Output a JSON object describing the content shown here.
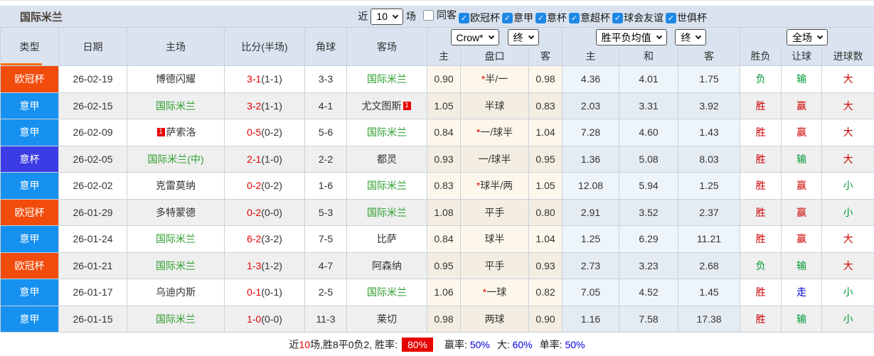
{
  "title": "国际米兰",
  "icons": {
    "check": "✓"
  },
  "colors": {
    "league": {
      "ucl": "#f14c0c",
      "serie_a": "#1791f0",
      "coppa": "#3c3ce6"
    },
    "inter_green": "#2e9e2e",
    "score_red": "#e60000",
    "star_red": "#e60000",
    "result": {
      "red": "#cc0000",
      "green": "#009933",
      "blue": "#0000cc"
    },
    "footer_red": "#e60000",
    "footer_blue": "#0000e0",
    "checkbox_blue": "#1e88e5",
    "accent_orange": "#ff7214"
  },
  "toolbar": {
    "recent_label": "近",
    "recent_value": "10",
    "matches_label": "场",
    "filters": [
      {
        "key": "same-venue",
        "label": "同客",
        "checked": false
      },
      {
        "key": "ucl",
        "label": "欧冠杯",
        "checked": true
      },
      {
        "key": "serie-a",
        "label": "意甲",
        "checked": true
      },
      {
        "key": "coppa-italia",
        "label": "意杯",
        "checked": true
      },
      {
        "key": "italian-super-cup",
        "label": "意超杯",
        "checked": true
      },
      {
        "key": "club-friendly",
        "label": "球会友谊",
        "checked": true
      },
      {
        "key": "club-world-cup",
        "label": "世俱杯",
        "checked": true
      }
    ]
  },
  "table": {
    "column_headers": [
      "类型",
      "日期",
      "主场",
      "比分(半场)",
      "角球",
      "客场"
    ],
    "sub_headers": [
      "主",
      "盘口",
      "客",
      "主",
      "和",
      "客",
      "胜负",
      "让球",
      "进球数"
    ],
    "selects": {
      "company": "Crow*",
      "company_time": "终",
      "avg": "胜平负均值",
      "avg_time": "终",
      "scope": "全场"
    },
    "rows": [
      {
        "league": "欧冠杯",
        "league_color": "ucl",
        "date": "26-02-19",
        "home": {
          "name": "博德闪耀",
          "inter": false,
          "red_card": null
        },
        "score": {
          "full": "3-1",
          "half": "(1-1)"
        },
        "corners": "3-3",
        "away": {
          "name": "国际米兰",
          "inter": true,
          "red_card": null
        },
        "crow": {
          "home": "0.90",
          "star": "*",
          "handicap": "半/一",
          "away": "0.98"
        },
        "avg": {
          "win": "4.36",
          "draw": "4.01",
          "lose": "1.75"
        },
        "results": {
          "outcome": {
            "text": "负",
            "color": "green"
          },
          "handicap": {
            "text": "输",
            "color": "green"
          },
          "goals": {
            "text": "大",
            "color": "red"
          }
        }
      },
      {
        "league": "意甲",
        "league_color": "serie_a",
        "date": "26-02-15",
        "home": {
          "name": "国际米兰",
          "inter": true,
          "red_card": null
        },
        "score": {
          "full": "3-2",
          "half": "(1-1)"
        },
        "corners": "4-1",
        "away": {
          "name": "尤文图斯",
          "inter": false,
          "red_card": {
            "count": "1",
            "position": "after"
          }
        },
        "crow": {
          "home": "1.05",
          "star": "",
          "handicap": "半球",
          "away": "0.83"
        },
        "avg": {
          "win": "2.03",
          "draw": "3.31",
          "lose": "3.92"
        },
        "results": {
          "outcome": {
            "text": "胜",
            "color": "red"
          },
          "handicap": {
            "text": "赢",
            "color": "red"
          },
          "goals": {
            "text": "大",
            "color": "red"
          }
        }
      },
      {
        "league": "意甲",
        "league_color": "serie_a",
        "date": "26-02-09",
        "home": {
          "name": "萨索洛",
          "inter": false,
          "red_card": {
            "count": "1",
            "position": "before"
          }
        },
        "score": {
          "full": "0-5",
          "half": "(0-2)"
        },
        "corners": "5-6",
        "away": {
          "name": "国际米兰",
          "inter": true,
          "red_card": null
        },
        "crow": {
          "home": "0.84",
          "star": "*",
          "handicap": "一/球半",
          "away": "1.04"
        },
        "avg": {
          "win": "7.28",
          "draw": "4.60",
          "lose": "1.43"
        },
        "results": {
          "outcome": {
            "text": "胜",
            "color": "red"
          },
          "handicap": {
            "text": "赢",
            "color": "red"
          },
          "goals": {
            "text": "大",
            "color": "red"
          }
        }
      },
      {
        "league": "意杯",
        "league_color": "coppa",
        "date": "26-02-05",
        "home": {
          "name": "国际米兰(中)",
          "inter": true,
          "red_card": null
        },
        "score": {
          "full": "2-1",
          "half": "(1-0)"
        },
        "corners": "2-2",
        "away": {
          "name": "都灵",
          "inter": false,
          "red_card": null
        },
        "crow": {
          "home": "0.93",
          "star": "",
          "handicap": "一/球半",
          "away": "0.95"
        },
        "avg": {
          "win": "1.36",
          "draw": "5.08",
          "lose": "8.03"
        },
        "results": {
          "outcome": {
            "text": "胜",
            "color": "red"
          },
          "handicap": {
            "text": "输",
            "color": "green"
          },
          "goals": {
            "text": "大",
            "color": "red"
          }
        }
      },
      {
        "league": "意甲",
        "league_color": "serie_a",
        "date": "26-02-02",
        "home": {
          "name": "克雷莫纳",
          "inter": false,
          "red_card": null
        },
        "score": {
          "full": "0-2",
          "half": "(0-2)"
        },
        "corners": "1-6",
        "away": {
          "name": "国际米兰",
          "inter": true,
          "red_card": null
        },
        "crow": {
          "home": "0.83",
          "star": "*",
          "handicap": "球半/两",
          "away": "1.05"
        },
        "avg": {
          "win": "12.08",
          "draw": "5.94",
          "lose": "1.25"
        },
        "results": {
          "outcome": {
            "text": "胜",
            "color": "red"
          },
          "handicap": {
            "text": "赢",
            "color": "red"
          },
          "goals": {
            "text": "小",
            "color": "green"
          }
        }
      },
      {
        "league": "欧冠杯",
        "league_color": "ucl",
        "date": "26-01-29",
        "home": {
          "name": "多特蒙德",
          "inter": false,
          "red_card": null
        },
        "score": {
          "full": "0-2",
          "half": "(0-0)"
        },
        "corners": "5-3",
        "away": {
          "name": "国际米兰",
          "inter": true,
          "red_card": null
        },
        "crow": {
          "home": "1.08",
          "star": "",
          "handicap": "平手",
          "away": "0.80"
        },
        "avg": {
          "win": "2.91",
          "draw": "3.52",
          "lose": "2.37"
        },
        "results": {
          "outcome": {
            "text": "胜",
            "color": "red"
          },
          "handicap": {
            "text": "赢",
            "color": "red"
          },
          "goals": {
            "text": "小",
            "color": "green"
          }
        }
      },
      {
        "league": "意甲",
        "league_color": "serie_a",
        "date": "26-01-24",
        "home": {
          "name": "国际米兰",
          "inter": true,
          "red_card": null
        },
        "score": {
          "full": "6-2",
          "half": "(3-2)"
        },
        "corners": "7-5",
        "away": {
          "name": "比萨",
          "inter": false,
          "red_card": null
        },
        "crow": {
          "home": "0.84",
          "star": "",
          "handicap": "球半",
          "away": "1.04"
        },
        "avg": {
          "win": "1.25",
          "draw": "6.29",
          "lose": "11.21"
        },
        "results": {
          "outcome": {
            "text": "胜",
            "color": "red"
          },
          "handicap": {
            "text": "赢",
            "color": "red"
          },
          "goals": {
            "text": "大",
            "color": "red"
          }
        }
      },
      {
        "league": "欧冠杯",
        "league_color": "ucl",
        "date": "26-01-21",
        "home": {
          "name": "国际米兰",
          "inter": true,
          "red_card": null
        },
        "score": {
          "full": "1-3",
          "half": "(1-2)"
        },
        "corners": "4-7",
        "away": {
          "name": "阿森纳",
          "inter": false,
          "red_card": null
        },
        "crow": {
          "home": "0.95",
          "star": "",
          "handicap": "平手",
          "away": "0.93"
        },
        "avg": {
          "win": "2.73",
          "draw": "3.23",
          "lose": "2.68"
        },
        "results": {
          "outcome": {
            "text": "负",
            "color": "green"
          },
          "handicap": {
            "text": "输",
            "color": "green"
          },
          "goals": {
            "text": "大",
            "color": "red"
          }
        }
      },
      {
        "league": "意甲",
        "league_color": "serie_a",
        "date": "26-01-17",
        "home": {
          "name": "乌迪内斯",
          "inter": false,
          "red_card": null
        },
        "score": {
          "full": "0-1",
          "half": "(0-1)"
        },
        "corners": "2-5",
        "away": {
          "name": "国际米兰",
          "inter": true,
          "red_card": null
        },
        "crow": {
          "home": "1.06",
          "star": "*",
          "handicap": "一球",
          "away": "0.82"
        },
        "avg": {
          "win": "7.05",
          "draw": "4.52",
          "lose": "1.45"
        },
        "results": {
          "outcome": {
            "text": "胜",
            "color": "red"
          },
          "handicap": {
            "text": "走",
            "color": "blue"
          },
          "goals": {
            "text": "小",
            "color": "green"
          }
        }
      },
      {
        "league": "意甲",
        "league_color": "serie_a",
        "date": "26-01-15",
        "home": {
          "name": "国际米兰",
          "inter": true,
          "red_card": null
        },
        "score": {
          "full": "1-0",
          "half": "(0-0)"
        },
        "corners": "11-3",
        "away": {
          "name": "莱切",
          "inter": false,
          "red_card": null
        },
        "crow": {
          "home": "0.98",
          "star": "",
          "handicap": "两球",
          "away": "0.90"
        },
        "avg": {
          "win": "1.16",
          "draw": "7.58",
          "lose": "17.38"
        },
        "results": {
          "outcome": {
            "text": "胜",
            "color": "red"
          },
          "handicap": {
            "text": "输",
            "color": "green"
          },
          "goals": {
            "text": "小",
            "color": "green"
          }
        }
      }
    ]
  },
  "footer": {
    "prefix": "近",
    "count": "10",
    "record": "场,胜8平0负2, 胜率:",
    "win_rate": "80%",
    "stats": [
      {
        "label": "赢率:",
        "value": "50%"
      },
      {
        "label": "大:",
        "value": "60%"
      },
      {
        "label": "单率:",
        "value": "50%"
      }
    ]
  }
}
